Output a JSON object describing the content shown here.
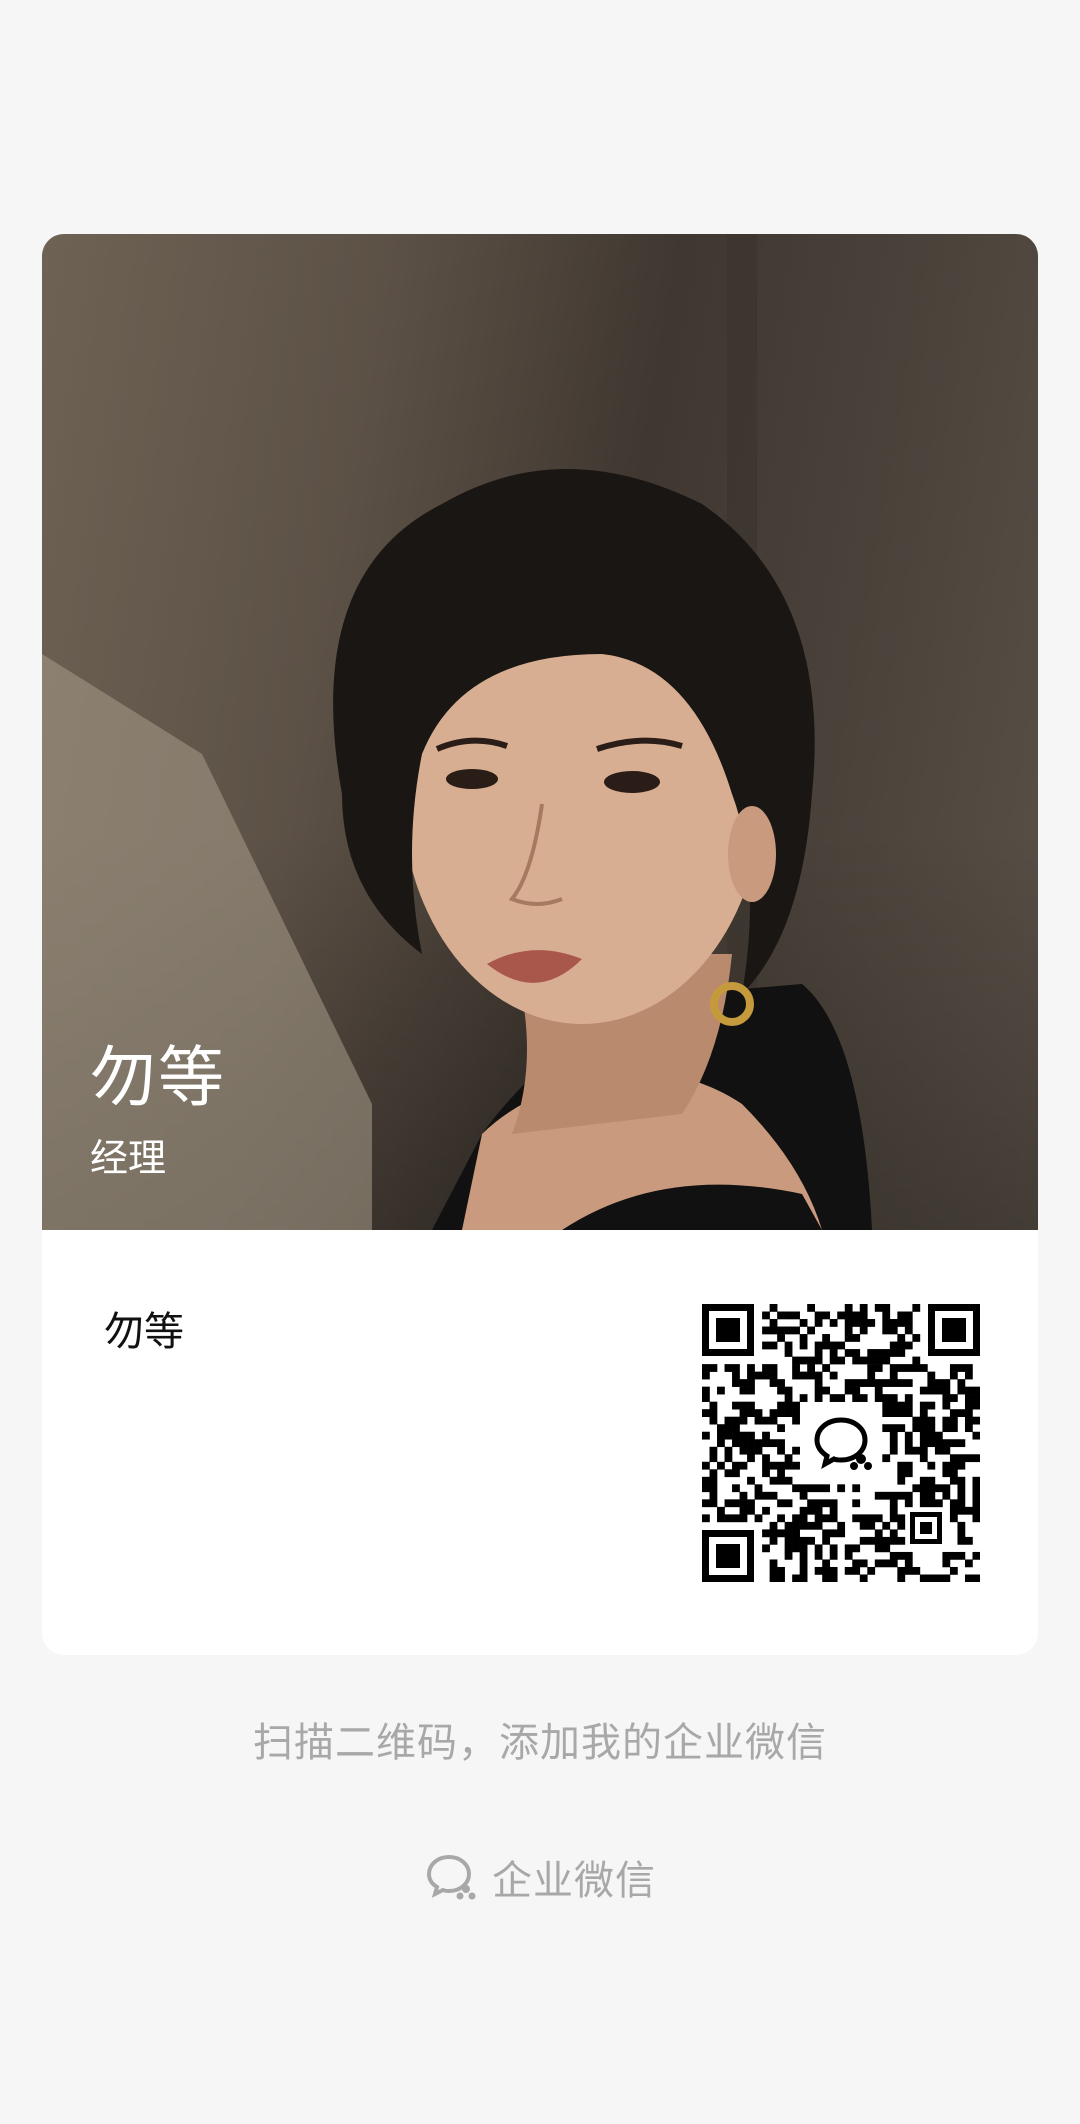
{
  "profile": {
    "name": "勿等",
    "title": "经理"
  },
  "card": {
    "name": "勿等"
  },
  "footer": {
    "hint": "扫描二维码，添加我的企业微信",
    "brand_label": "企业微信",
    "brand_icon": "wecom-icon"
  },
  "qr": {
    "center_icon": "wecom-icon"
  }
}
